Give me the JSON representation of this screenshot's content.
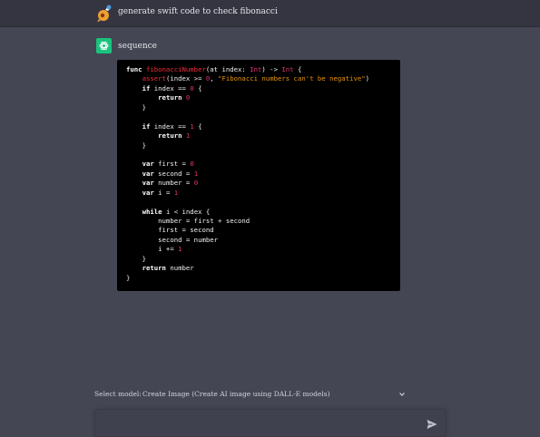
{
  "user_message": {
    "text": "generate swift code to check fibonacci"
  },
  "assistant_message": {
    "title": "sequence",
    "code_lines": [
      [
        {
          "t": "kw",
          "v": "func "
        },
        {
          "t": "fn",
          "v": "fibonacciNumber"
        },
        {
          "t": "pl",
          "v": "(at index: "
        },
        {
          "t": "ty",
          "v": "Int"
        },
        {
          "t": "pl",
          "v": ") -> "
        },
        {
          "t": "ty",
          "v": "Int"
        },
        {
          "t": "pl",
          "v": " {"
        }
      ],
      [
        {
          "t": "pl",
          "v": "    "
        },
        {
          "t": "fn",
          "v": "assert"
        },
        {
          "t": "pl",
          "v": "(index >= "
        },
        {
          "t": "num",
          "v": "0"
        },
        {
          "t": "pl",
          "v": ", "
        },
        {
          "t": "str",
          "v": "\"Fibonacci numbers can't be negative\""
        },
        {
          "t": "pl",
          "v": ")"
        }
      ],
      [
        {
          "t": "pl",
          "v": "    "
        },
        {
          "t": "kw",
          "v": "if"
        },
        {
          "t": "pl",
          "v": " index == "
        },
        {
          "t": "num",
          "v": "0"
        },
        {
          "t": "pl",
          "v": " {"
        }
      ],
      [
        {
          "t": "pl",
          "v": "        "
        },
        {
          "t": "kw",
          "v": "return "
        },
        {
          "t": "num",
          "v": "0"
        }
      ],
      [
        {
          "t": "pl",
          "v": "    }"
        }
      ],
      [
        {
          "t": "pl",
          "v": ""
        }
      ],
      [
        {
          "t": "pl",
          "v": "    "
        },
        {
          "t": "kw",
          "v": "if"
        },
        {
          "t": "pl",
          "v": " index == "
        },
        {
          "t": "num",
          "v": "1"
        },
        {
          "t": "pl",
          "v": " {"
        }
      ],
      [
        {
          "t": "pl",
          "v": "        "
        },
        {
          "t": "kw",
          "v": "return "
        },
        {
          "t": "num",
          "v": "1"
        }
      ],
      [
        {
          "t": "pl",
          "v": "    }"
        }
      ],
      [
        {
          "t": "pl",
          "v": ""
        }
      ],
      [
        {
          "t": "pl",
          "v": "    "
        },
        {
          "t": "kw",
          "v": "var"
        },
        {
          "t": "pl",
          "v": " first = "
        },
        {
          "t": "num",
          "v": "0"
        }
      ],
      [
        {
          "t": "pl",
          "v": "    "
        },
        {
          "t": "kw",
          "v": "var"
        },
        {
          "t": "pl",
          "v": " second = "
        },
        {
          "t": "num",
          "v": "1"
        }
      ],
      [
        {
          "t": "pl",
          "v": "    "
        },
        {
          "t": "kw",
          "v": "var"
        },
        {
          "t": "pl",
          "v": " number = "
        },
        {
          "t": "num",
          "v": "0"
        }
      ],
      [
        {
          "t": "pl",
          "v": "    "
        },
        {
          "t": "kw",
          "v": "var"
        },
        {
          "t": "pl",
          "v": " i = "
        },
        {
          "t": "num",
          "v": "1"
        }
      ],
      [
        {
          "t": "pl",
          "v": ""
        }
      ],
      [
        {
          "t": "pl",
          "v": "    "
        },
        {
          "t": "kw",
          "v": "while"
        },
        {
          "t": "pl",
          "v": " i < index {"
        }
      ],
      [
        {
          "t": "pl",
          "v": "        number = first + second"
        }
      ],
      [
        {
          "t": "pl",
          "v": "        first = second"
        }
      ],
      [
        {
          "t": "pl",
          "v": "        second = number"
        }
      ],
      [
        {
          "t": "pl",
          "v": "        i += "
        },
        {
          "t": "num",
          "v": "1"
        }
      ],
      [
        {
          "t": "pl",
          "v": "    }"
        }
      ],
      [
        {
          "t": "pl",
          "v": "    "
        },
        {
          "t": "kw",
          "v": "return"
        },
        {
          "t": "pl",
          "v": " number"
        }
      ],
      [
        {
          "t": "pl",
          "v": "}"
        }
      ]
    ]
  },
  "model_select": {
    "label": "Select model:",
    "value": "Create Image (Create AI image using DALL-E models)"
  },
  "prompt": {
    "value": "",
    "placeholder": ""
  },
  "icons": {
    "user_avatar": "user-avatar-icon",
    "assistant_avatar": "openai-logo-icon",
    "chevron": "chevron-down-icon",
    "send": "send-icon"
  },
  "colors": {
    "background": "#444654",
    "header": "#343541",
    "code_background": "#000000",
    "assistant_avatar": "#19c37d",
    "input_background": "#40414f"
  }
}
